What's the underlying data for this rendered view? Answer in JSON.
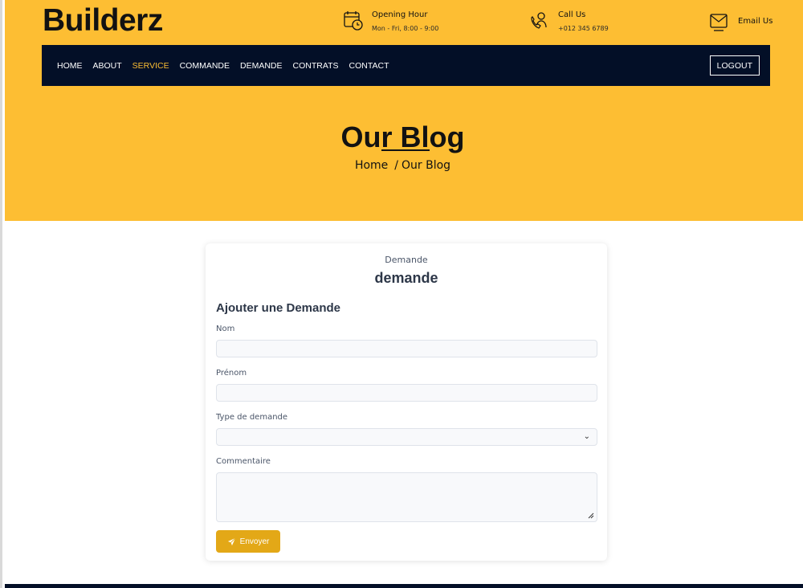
{
  "header": {
    "brand": "Builderz",
    "opening": {
      "title": "Opening Hour",
      "detail": "Mon - Fri, 8:00 - 9:00",
      "icon": "calendar-clock-icon"
    },
    "call": {
      "title": "Call Us",
      "detail": "+012 345 6789",
      "icon": "phone-support-icon"
    },
    "email": {
      "title": "Email Us",
      "icon": "email-icon"
    }
  },
  "nav": {
    "items": [
      "HOME",
      "ABOUT",
      "SERVICE",
      "COMMANDE",
      "DEMANDE",
      "CONTRATS",
      "CONTACT"
    ],
    "active": "SERVICE",
    "logout": "LOGOUT"
  },
  "hero": {
    "title": "Our Blog",
    "breadcrumb_home": "Home",
    "breadcrumb_sep": "/",
    "breadcrumb_current": "Our Blog"
  },
  "card": {
    "subtitle": "Demande",
    "title": "demande",
    "form_heading": "Ajouter une Demande",
    "fields": {
      "nom_label": "Nom",
      "nom_value": "",
      "prenom_label": "Prénom",
      "prenom_value": "",
      "type_label": "Type de demande",
      "type_value": "",
      "commentaire_label": "Commentaire",
      "commentaire_value": ""
    },
    "submit_label": "Envoyer"
  },
  "colors": {
    "accent": "#fdbe33",
    "navbar": "#030f27",
    "button": "#e3a817"
  }
}
